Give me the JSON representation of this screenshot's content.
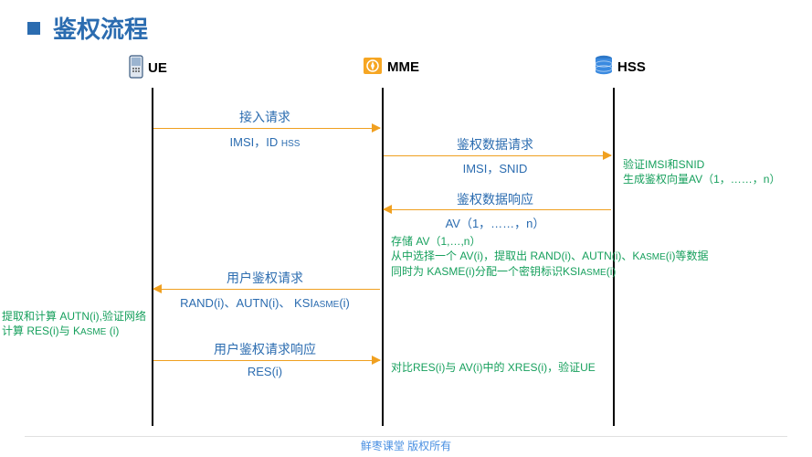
{
  "title": "鉴权流程",
  "nodes": {
    "ue": "UE",
    "mme": "MME",
    "hss": "HSS"
  },
  "messages": {
    "m1": {
      "label": "接入请求",
      "sub": "IMSI，ID ",
      "subSc": "HSS"
    },
    "m2": {
      "label": "鉴权数据请求",
      "sub": "IMSI，SNID"
    },
    "m3": {
      "label": "鉴权数据响应",
      "sub": "AV（1，……，n）"
    },
    "m4": {
      "label": "用户鉴权请求",
      "sub": "RAND(i)、AUTN(i)、 KSI",
      "subSc": "ASME",
      "subTail": "(i)"
    },
    "m5": {
      "label": "用户鉴权请求响应",
      "sub": "RES(i)"
    }
  },
  "notes": {
    "n1a": "验证IMSI和SNID",
    "n1b": "生成鉴权向量AV（1，……，n）",
    "n2a": "存储 AV（1,…,n）",
    "n2b_pre": "从中选择一个 AV(i)，提取出 RAND(i)、AUTN(i)、K",
    "n2b_sc": "ASME",
    "n2b_post": "(i)等数据",
    "n2c_pre": "同时为 KASME(i)分配一个密钥标识KSI",
    "n2c_sc": "ASME",
    "n2c_post": "(i)",
    "n3a": "提取和计算 AUTN(i),验证网络",
    "n3b_pre": "计算 RES(i)与 K",
    "n3b_sc": "ASME",
    "n3b_post": " (i)",
    "n4": "对比RES(i)与 AV(i)中的 XRES(i)，验证UE"
  },
  "footer": "鲜枣课堂  版权所有"
}
